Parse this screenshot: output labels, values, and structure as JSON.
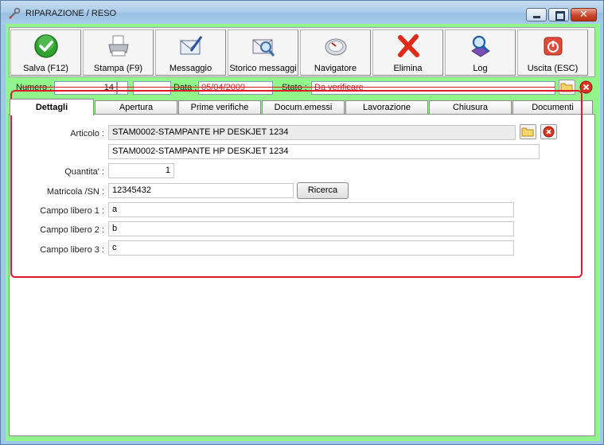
{
  "window": {
    "title": "RIPARAZIONE / RESO"
  },
  "toolbar": [
    {
      "label": "Salva (F12)",
      "icon": "check-icon"
    },
    {
      "label": "Stampa (F9)",
      "icon": "printer-icon"
    },
    {
      "label": "Messaggio",
      "icon": "envelope-pen-icon"
    },
    {
      "label": "Storico messaggi",
      "icon": "envelope-search-icon"
    },
    {
      "label": "Navigatore",
      "icon": "compass-icon"
    },
    {
      "label": "Elimina",
      "icon": "delete-x-icon"
    },
    {
      "label": "Log",
      "icon": "log-search-icon"
    },
    {
      "label": "Uscita (ESC)",
      "icon": "power-icon"
    }
  ],
  "header": {
    "numero_label": "Numero :",
    "numero_value": "14",
    "data_label": "Data :",
    "data_value": "05/04/2009",
    "stato_label": "Stato :",
    "stato_value": "Da verificare"
  },
  "tabs": [
    "Dettagli",
    "Apertura",
    "Prime verifiche",
    "Docum.emessi",
    "Lavorazione",
    "Chiusura",
    "Documenti"
  ],
  "form": {
    "articolo_label": "Articolo :",
    "articolo_code": "STAM0002-STAMPANTE HP DESKJET 1234",
    "articolo_desc": "STAM0002-STAMPANTE HP DESKJET 1234",
    "quantita_label": "Quantita' :",
    "quantita_value": "1",
    "matricola_label": "Matricola /SN :",
    "matricola_value": "12345432",
    "ricerca_label": "Ricerca",
    "campo1_label": "Campo libero 1 :",
    "campo1_value": "a",
    "campo2_label": "Campo libero 2 :",
    "campo2_value": "b",
    "campo3_label": "Campo libero 3 :",
    "campo3_value": "c"
  },
  "colors": {
    "client_background": "#92f58c",
    "highlight_border": "#e0182a",
    "title_bar": "#a9cbe9"
  }
}
